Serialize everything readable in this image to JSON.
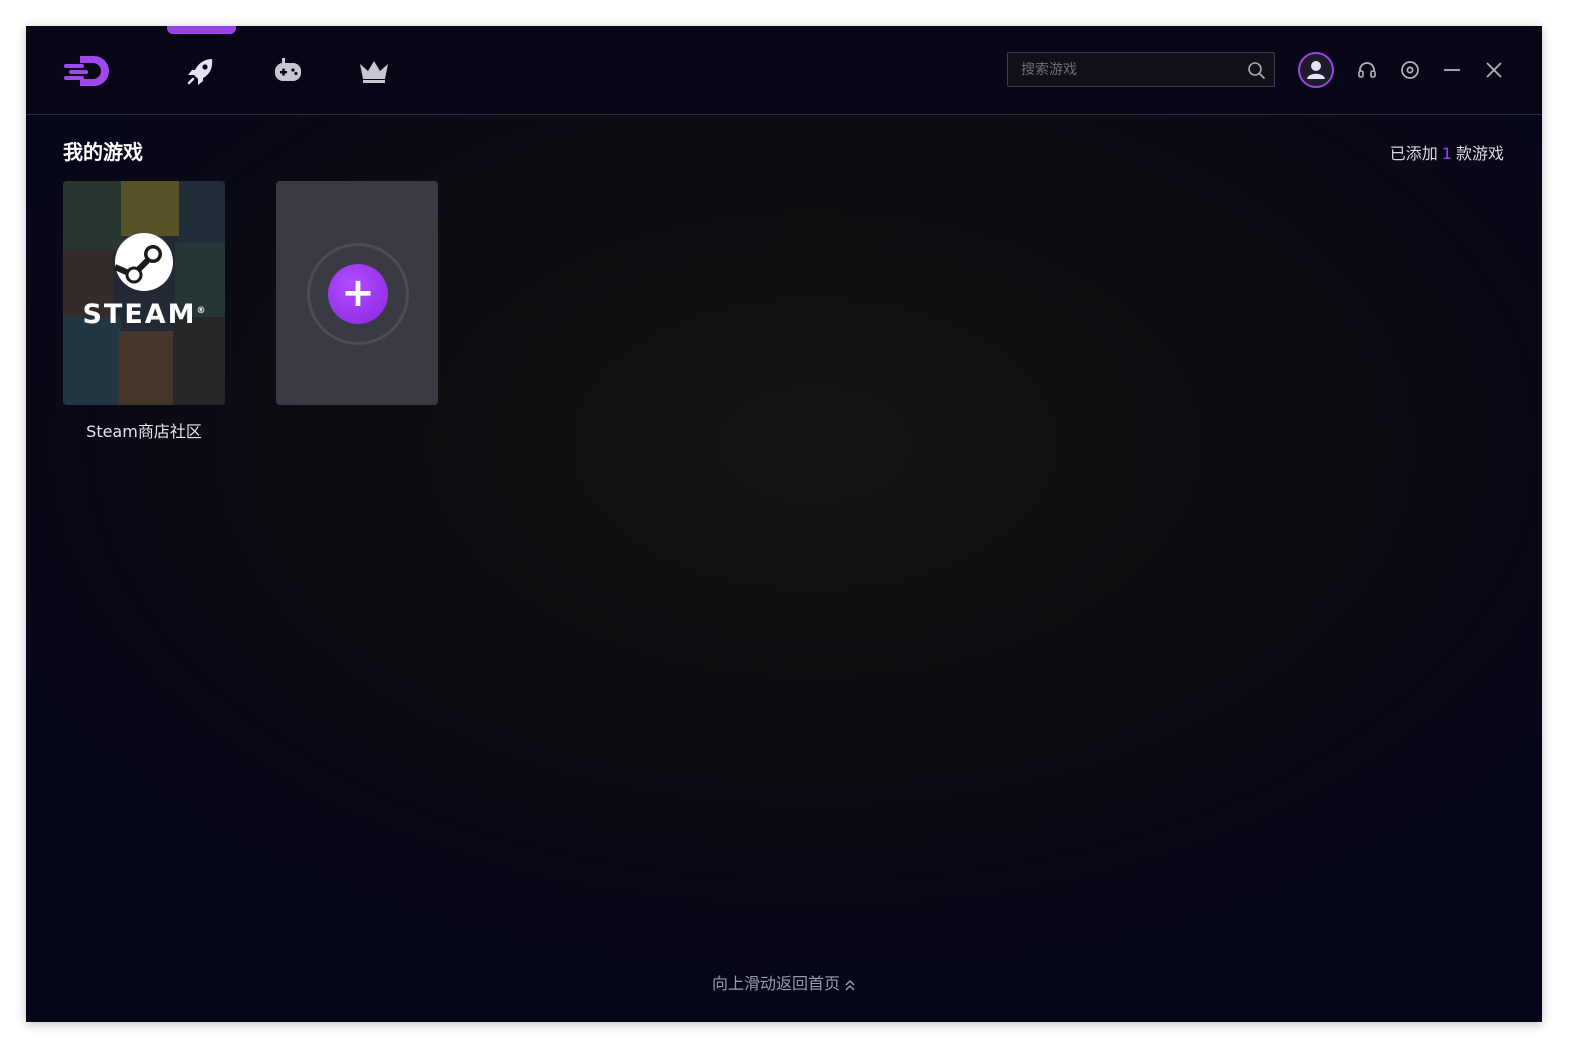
{
  "search": {
    "placeholder": "搜索游戏"
  },
  "my_games": {
    "title": "我的游戏",
    "added_prefix": "已添加",
    "added_count": "1",
    "added_suffix": "款游戏",
    "games": [
      {
        "name": "Steam商店社区",
        "cover_text": "STEAM"
      }
    ]
  },
  "footer": {
    "scroll_hint": "向上滑动返回首页"
  },
  "colors": {
    "accent": "#9b42e8",
    "titlebar": "#060617",
    "background": "#0d0d12"
  }
}
